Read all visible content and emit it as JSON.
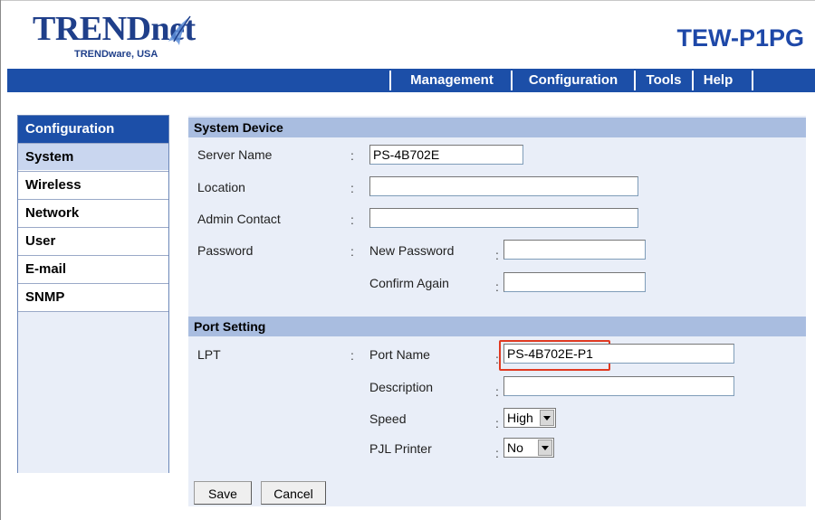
{
  "header": {
    "logo_text": "TRENDnet",
    "logo_subtext": "TRENDware, USA",
    "product": "TEW-P1PG"
  },
  "nav": {
    "items": [
      "Management",
      "Configuration",
      "Tools",
      "Help"
    ]
  },
  "menu": {
    "title": "Configuration",
    "items": [
      "System",
      "Wireless",
      "Network",
      "User",
      "E-mail",
      "SNMP"
    ],
    "active": "System"
  },
  "system_device": {
    "section_title": "System Device",
    "server_name_label": "Server Name",
    "server_name_value": "PS-4B702E",
    "location_label": "Location",
    "location_value": "",
    "admin_contact_label": "Admin Contact",
    "admin_contact_value": "",
    "password_label": "Password",
    "new_password_label": "New Password",
    "new_password_value": "",
    "confirm_again_label": "Confirm Again",
    "confirm_again_value": ""
  },
  "port_setting": {
    "section_title": "Port Setting",
    "lpt_label": "LPT",
    "port_name_label": "Port Name",
    "port_name_value": "PS-4B702E-P1",
    "description_label": "Description",
    "description_value": "",
    "speed_label": "Speed",
    "speed_value": "High",
    "pjl_label": "PJL Printer",
    "pjl_value": "No"
  },
  "buttons": {
    "save": "Save",
    "cancel": "Cancel"
  },
  "colors": {
    "nav_bar": "#1c4fa8",
    "section_header": "#a9bde0",
    "panel_bg": "#e9eef8",
    "highlight": "#e03a22"
  }
}
